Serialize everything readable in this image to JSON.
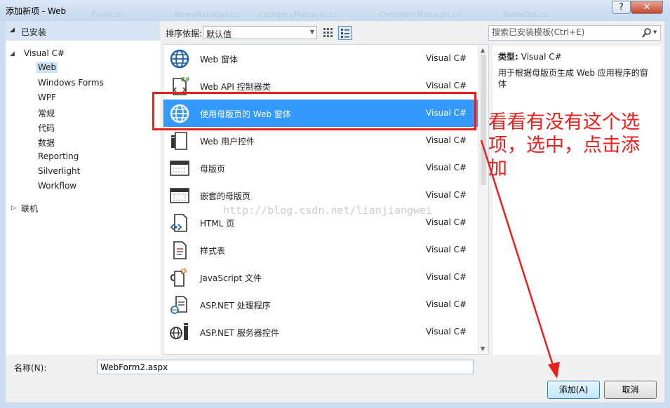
{
  "window": {
    "title": "添加新项 - Web",
    "help_label": "?",
    "close_label": "✕",
    "ghost_tabs": [
      "Projects",
      "NewsManager.cs",
      "CategoryManager.cs",
      "CommentManager.cs",
      "NewsDal.cs"
    ]
  },
  "left_panel": {
    "installed_label": "已安装",
    "tree": {
      "root": "Visual C#",
      "children": [
        "Web",
        "Windows Forms",
        "WPF",
        "常规",
        "代码",
        "数据",
        "Reporting",
        "Silverlight",
        "Workflow"
      ],
      "selected": "Web",
      "online": "联机"
    }
  },
  "toolbar": {
    "sort_label": "排序依据:",
    "sort_value": "默认值"
  },
  "templates": [
    {
      "name": "Web 窗体",
      "lang": "Visual C#",
      "icon": "globe-icon"
    },
    {
      "name": "Web API 控制器类",
      "lang": "Visual C#",
      "icon": "web-api-controller-icon"
    },
    {
      "name": "使用母版页的 Web 窗体",
      "lang": "Visual C#",
      "icon": "globe-icon",
      "selected": true
    },
    {
      "name": "Web 用户控件",
      "lang": "Visual C#",
      "icon": "user-control-icon"
    },
    {
      "name": "母版页",
      "lang": "Visual C#",
      "icon": "master-page-icon"
    },
    {
      "name": "嵌套的母版页",
      "lang": "Visual C#",
      "icon": "nested-master-page-icon"
    },
    {
      "name": "HTML 页",
      "lang": "Visual C#",
      "icon": "html-page-icon"
    },
    {
      "name": "样式表",
      "lang": "Visual C#",
      "icon": "stylesheet-icon"
    },
    {
      "name": "JavaScript 文件",
      "lang": "Visual C#",
      "icon": "javascript-file-icon"
    },
    {
      "name": "ASP.NET 处理程序",
      "lang": "Visual C#",
      "icon": "handler-icon"
    },
    {
      "name": "ASP.NET 服务器控件",
      "lang": "Visual C#",
      "icon": "server-control-icon"
    }
  ],
  "watermark": "http://blog.csdn.net/lianjiangwei",
  "search": {
    "placeholder": "搜索已安装模板(Ctrl+E)"
  },
  "info": {
    "type_label": "类型:",
    "type_value": "Visual C#",
    "description": "用于根据母版页生成 Web 应用程序的窗体"
  },
  "bottom": {
    "name_label": "名称(N):",
    "name_value": "WebForm2.aspx",
    "add_label": "添加(A)",
    "cancel_label": "取消"
  },
  "annotation": {
    "text": "看看有没有这个选项，选中，点击添加",
    "color": "#e8201c"
  },
  "colors": {
    "selection": "#3399ff",
    "tree_selection": "#cde2f6",
    "header_bg": "#d6e4f3"
  }
}
